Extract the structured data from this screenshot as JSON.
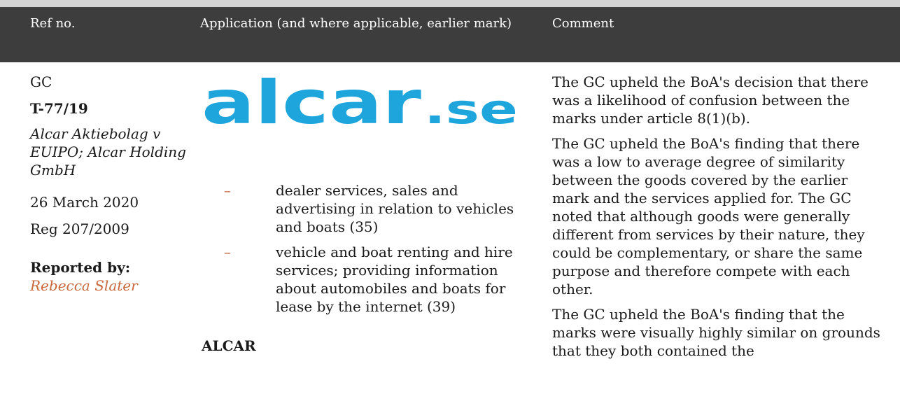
{
  "header": {
    "ref_no": "Ref no.",
    "application": "Application (and where applicable, earlier mark)",
    "comment": "Comment"
  },
  "case": {
    "court": "GC",
    "ref": "T-77/19",
    "parties": "Alcar Aktiebolag v EUIPO; Alcar Holding GmbH",
    "date": "26 March 2020",
    "regulation": "Reg 207/2009",
    "reported_by_label": "Reported by:",
    "reporter": "Rebecca Slater"
  },
  "application": {
    "logo_text_main": "alcar",
    "logo_text_suffix": ".se",
    "logo_color": "#1ea5dc",
    "goods": [
      "dealer services, sales and advertising in relation to vehicles and boats (35)",
      "vehicle and boat renting and hire services; providing information about automobiles and boats for lease by the internet (39)"
    ],
    "earlier_mark": "ALCAR"
  },
  "comment": {
    "paragraphs": [
      "The GC upheld the BoA's decision that there was a likelihood of confusion between the marks under article 8(1)(b).",
      "The GC upheld the BoA's finding that there was a low to average degree of similarity between the goods covered by the earlier mark and the services applied for. The GC noted that although goods were generally different from services by their nature, they could be complementary, or share the same purpose and therefore compete with each other.",
      "The GC upheld the BoA's finding that the marks were visually highly similar on grounds that they both contained the"
    ]
  }
}
